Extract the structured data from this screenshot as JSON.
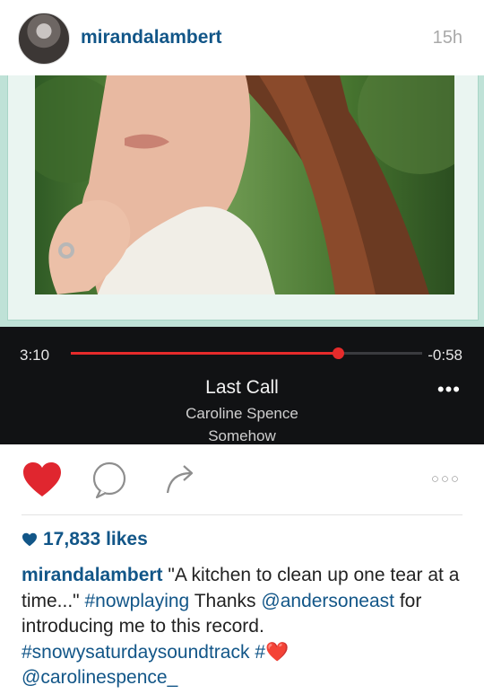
{
  "post": {
    "username": "mirandalambert",
    "time_ago": "15h"
  },
  "player": {
    "elapsed": "3:10",
    "remaining": "-0:58",
    "progress": 0.76,
    "title": "Last Call",
    "artist": "Caroline Spence",
    "album": "Somehow",
    "more_label": "•••"
  },
  "actions": {
    "more_label": "○○○",
    "like_color": "#e0262f"
  },
  "likes": {
    "text": "17,833 likes"
  },
  "caption": {
    "username": "mirandalambert",
    "text1": " \"A kitchen to clean up one tear at a time...\" ",
    "tag_nowplaying": "#nowplaying",
    "text2": " Thanks ",
    "mention_anderson": "@andersoneast",
    "text3": " for introducing me to this record. ",
    "tag_snowy": "#snowysaturdaysoundtrack",
    "text4": " #",
    "emoji": "❤️",
    "mention_caroline": "@carolinespence_"
  },
  "colors": {
    "link_blue": "#125688",
    "progress_red": "#e52b2b",
    "mint_frame": "#bfe2d7"
  }
}
